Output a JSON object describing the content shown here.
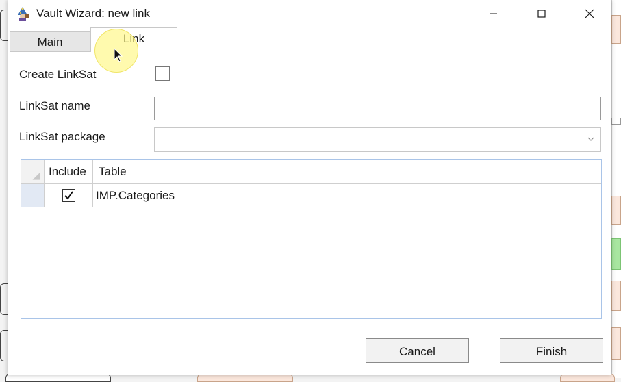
{
  "window": {
    "title": "Vault Wizard: new link",
    "icon": "wizard-app-icon"
  },
  "tabs": [
    {
      "label": "Main",
      "active": false
    },
    {
      "label": "Link",
      "active": true
    }
  ],
  "form": {
    "create_linksat_label": "Create LinkSat",
    "create_linksat_checked": false,
    "linksat_name_label": "LinkSat name",
    "linksat_name_value": "",
    "linksat_package_label": "LinkSat package",
    "linksat_package_value": ""
  },
  "grid": {
    "columns": [
      "Include",
      "Table"
    ],
    "rows": [
      {
        "include": true,
        "table": "IMP.Categories"
      }
    ]
  },
  "buttons": {
    "cancel": "Cancel",
    "finish": "Finish"
  },
  "colors": {
    "grid_border": "#a9c4e8",
    "row_selector": "#e2e9f4",
    "cursor_highlight": "#fff778"
  }
}
